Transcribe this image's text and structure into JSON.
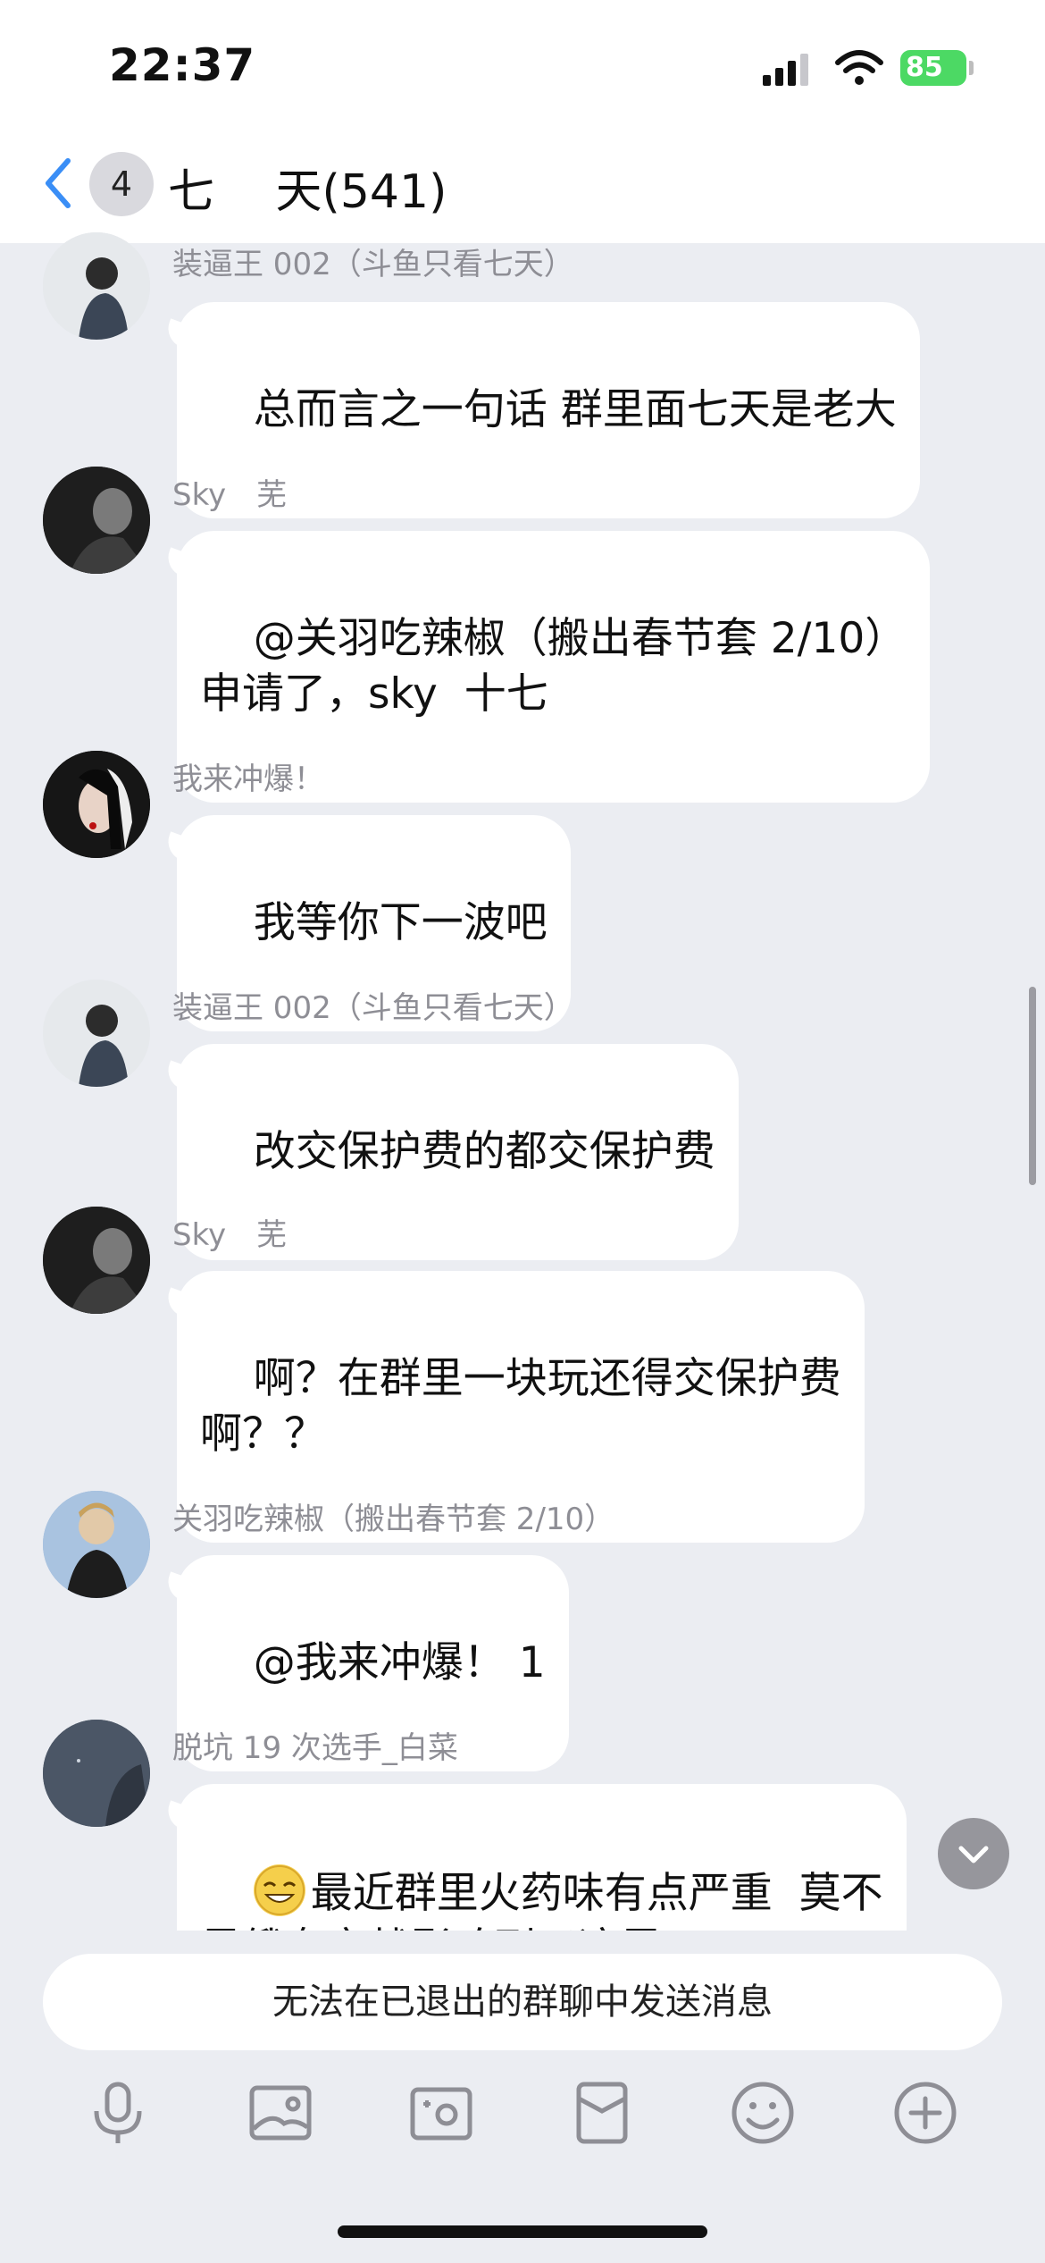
{
  "status_bar": {
    "time": "22:37",
    "battery": "85"
  },
  "nav": {
    "unread_count": "4",
    "title": "七　 天(541)"
  },
  "messages": [
    {
      "sender": "装逼王 002（斗鱼只看七天）",
      "text": "总而言之一句话 群里面七天是老大"
    },
    {
      "sender": "Sky　芜",
      "text": "@关羽吃辣椒（搬出春节套 2/10）\n申请了，sky  十七"
    },
    {
      "sender": "我来冲爆！",
      "text": "我等你下一波吧"
    },
    {
      "sender": "装逼王 002（斗鱼只看七天）",
      "text": "改交保护费的都交保护费"
    },
    {
      "sender": "Sky　芜",
      "text": "啊？在群里一块玩还得交保护费\n啊？？"
    },
    {
      "sender": "关羽吃辣椒（搬出春节套 2/10）",
      "text": "@我来冲爆！ 1"
    },
    {
      "sender": "脱坑 19 次选手_白菜",
      "text": "最近群里火药味有点严重  莫不\n是俄乌交战影响到了这里?"
    }
  ],
  "input": {
    "notice": "无法在已退出的群聊中发送消息"
  },
  "icons": {
    "back": "chevron-left-icon",
    "toolbar": [
      "microphone-icon",
      "image-icon",
      "camera-icon",
      "red-packet-icon",
      "emoji-icon",
      "plus-icon"
    ],
    "scroll_down": "chevron-down-icon"
  },
  "colors": {
    "accent": "#3a8ef6",
    "background": "#ebedf2",
    "bubble": "#ffffff",
    "battery": "#4cd964"
  }
}
